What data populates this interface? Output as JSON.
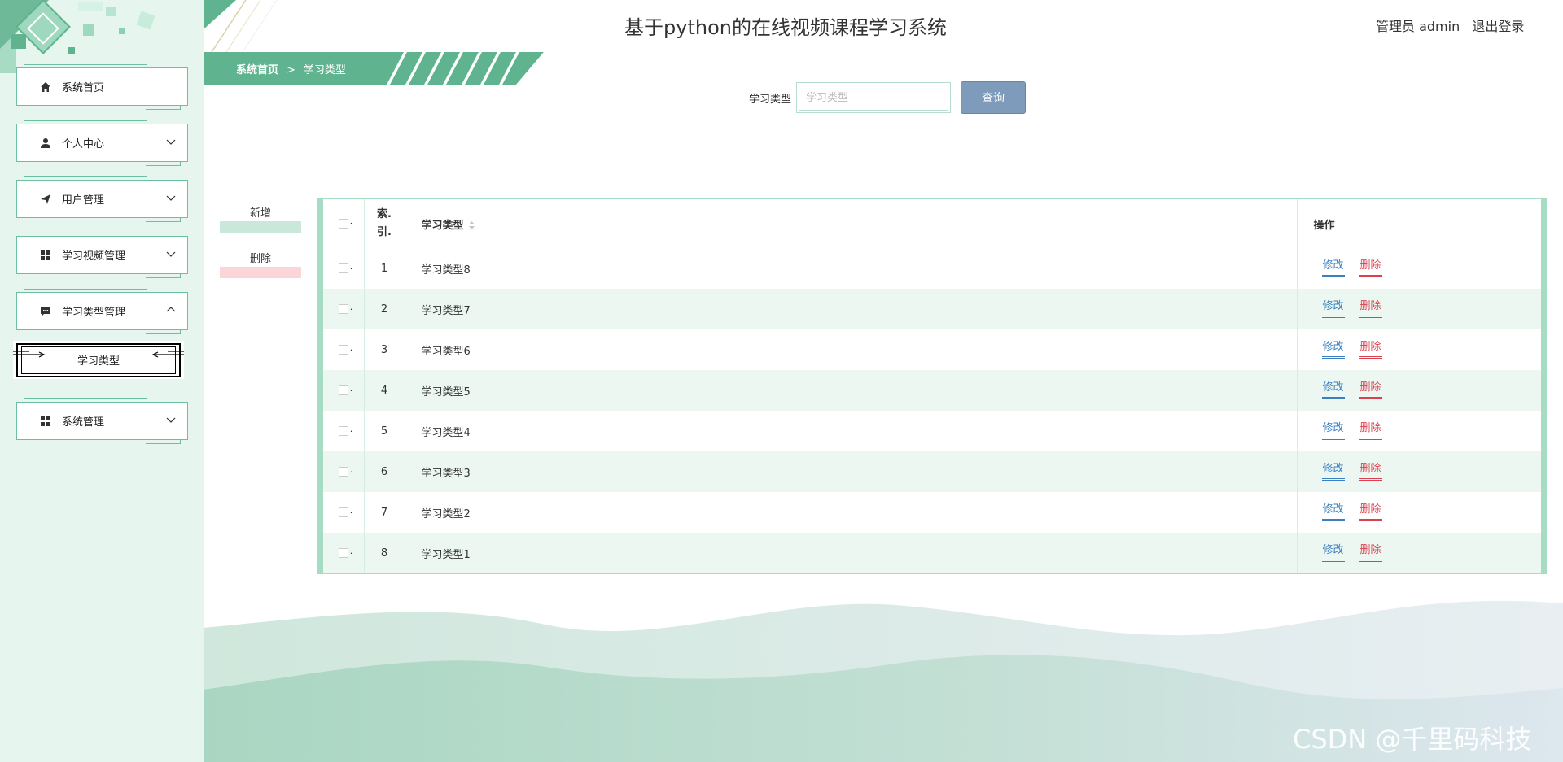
{
  "header": {
    "title": "基于python的在线视频课程学习系统",
    "user_label": "管理员 admin",
    "logout_label": "退出登录"
  },
  "breadcrumb": {
    "home": "系统首页",
    "separator": ">",
    "current": "学习类型"
  },
  "sidebar": {
    "items": [
      {
        "label": "系统首页",
        "icon": "home-icon"
      },
      {
        "label": "个人中心",
        "icon": "person-icon"
      },
      {
        "label": "用户管理",
        "icon": "send-icon"
      },
      {
        "label": "学习视频管理",
        "icon": "grid-icon"
      },
      {
        "label": "学习类型管理",
        "icon": "chat-icon"
      },
      {
        "label": "系统管理",
        "icon": "grid-icon"
      }
    ],
    "sub_item": {
      "label": "学习类型"
    }
  },
  "search": {
    "label": "学习类型",
    "placeholder": "学习类型",
    "value": "",
    "button": "查询"
  },
  "actions": {
    "add": "新增",
    "delete": "删除"
  },
  "table": {
    "headers": {
      "index_line1": "索.",
      "index_line2": "引.",
      "type": "学习类型",
      "ops": "操作"
    },
    "edit_label": "修改",
    "delete_label": "删除",
    "rows": [
      {
        "index": "1",
        "type": "学习类型8"
      },
      {
        "index": "2",
        "type": "学习类型7"
      },
      {
        "index": "3",
        "type": "学习类型6"
      },
      {
        "index": "4",
        "type": "学习类型5"
      },
      {
        "index": "5",
        "type": "学习类型4"
      },
      {
        "index": "6",
        "type": "学习类型3"
      },
      {
        "index": "7",
        "type": "学习类型2"
      },
      {
        "index": "8",
        "type": "学习类型1"
      }
    ]
  },
  "watermark": "CSDN @千里码科技",
  "colors": {
    "accent": "#5fb38e",
    "sidebar_bg": "#e6f5ee",
    "query_button": "#7f9bbc",
    "edit_link": "#3a7fc0",
    "delete_link": "#d9414f"
  }
}
